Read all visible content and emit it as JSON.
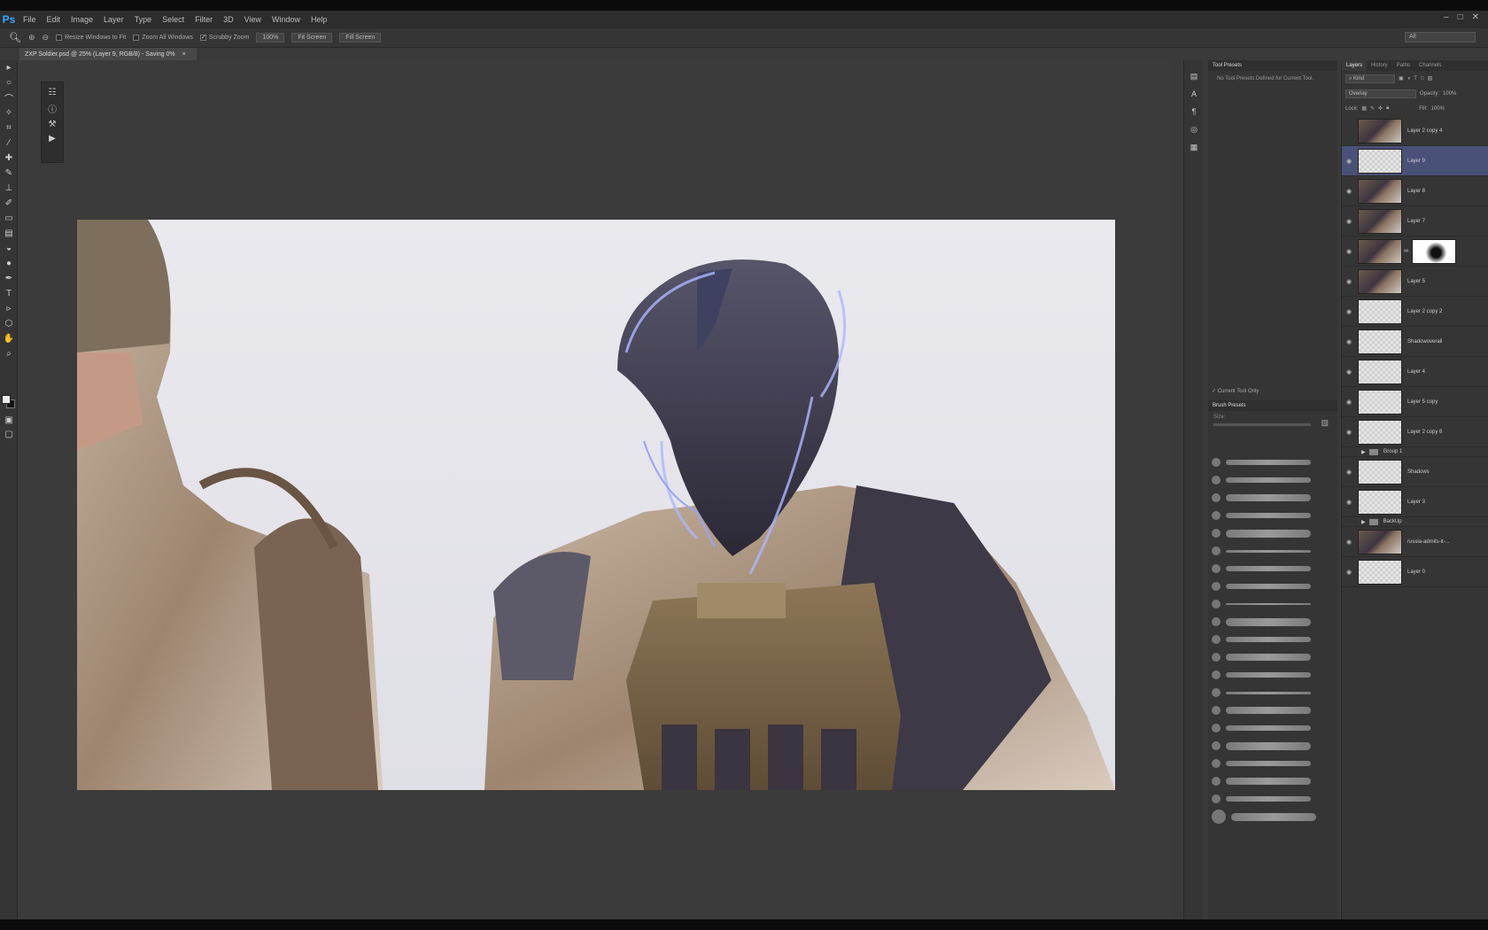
{
  "app": {
    "logo": "Ps"
  },
  "menu": [
    "File",
    "Edit",
    "Image",
    "Layer",
    "Type",
    "Select",
    "Filter",
    "3D",
    "View",
    "Window",
    "Help"
  ],
  "window_controls": [
    "–",
    "□",
    "✕"
  ],
  "options": {
    "resize_windows": "Resize Windows to Fit",
    "zoom_all": "Zoom All Windows",
    "scrubby_zoom": "Scrubby Zoom",
    "btn_100": "100%",
    "btn_fit": "Fit Screen",
    "btn_fill": "Fill Screen",
    "workspace": "All"
  },
  "document": {
    "tab_title": "ZXP Soldier.psd @ 25% (Layer 9, RGB/8) - Saving 0%",
    "close": "×"
  },
  "tool_presets": {
    "title": "Tool Presets",
    "empty": "No Tool Presets Defined for Current Tool.",
    "current_only": "Current Tool Only"
  },
  "brush_presets": {
    "title": "Brush Presets",
    "size_label": "Size:"
  },
  "layers_panel": {
    "tabs": [
      "Layers",
      "History",
      "Paths",
      "Channels"
    ],
    "filter": "Kind",
    "blend_mode": "Overlay",
    "opacity_label": "Opacity:",
    "opacity": "100%",
    "lock_label": "Lock:",
    "fill_label": "Fill:",
    "fill": "100%",
    "layers": [
      {
        "name": "Layer 2 copy 4",
        "thumb": "photo",
        "visible": false,
        "selected": false
      },
      {
        "name": "Layer 9",
        "thumb": "empty",
        "visible": true,
        "selected": true
      },
      {
        "name": "Layer 8",
        "thumb": "photo",
        "visible": true,
        "selected": false
      },
      {
        "name": "Layer 7",
        "thumb": "photo",
        "visible": true,
        "selected": false
      },
      {
        "name": "",
        "thumb": "photo",
        "visible": true,
        "selected": false,
        "mask": true
      },
      {
        "name": "Layer 5",
        "thumb": "photo",
        "visible": true,
        "selected": false
      },
      {
        "name": "Layer 2 copy 2",
        "thumb": "empty",
        "visible": true,
        "selected": false
      },
      {
        "name": "Shadowoverall",
        "thumb": "empty",
        "visible": true,
        "selected": false
      },
      {
        "name": "Layer 4",
        "thumb": "empty",
        "visible": true,
        "selected": false
      },
      {
        "name": "Layer 5 copy",
        "thumb": "empty",
        "visible": true,
        "selected": false
      },
      {
        "name": "Layer 2 copy 6",
        "thumb": "empty",
        "visible": true,
        "selected": false
      },
      {
        "name": "Group 1",
        "group": true,
        "visible": false
      },
      {
        "name": "Shadows",
        "thumb": "empty",
        "visible": true,
        "selected": false
      },
      {
        "name": "Layer 3",
        "thumb": "empty",
        "visible": true,
        "selected": false
      },
      {
        "name": "BackUp",
        "group": true,
        "visible": false
      },
      {
        "name": "russia-admits-it-...",
        "thumb": "photo",
        "visible": true,
        "selected": false
      },
      {
        "name": "Layer 0",
        "thumb": "empty",
        "visible": true,
        "selected": false
      }
    ]
  }
}
